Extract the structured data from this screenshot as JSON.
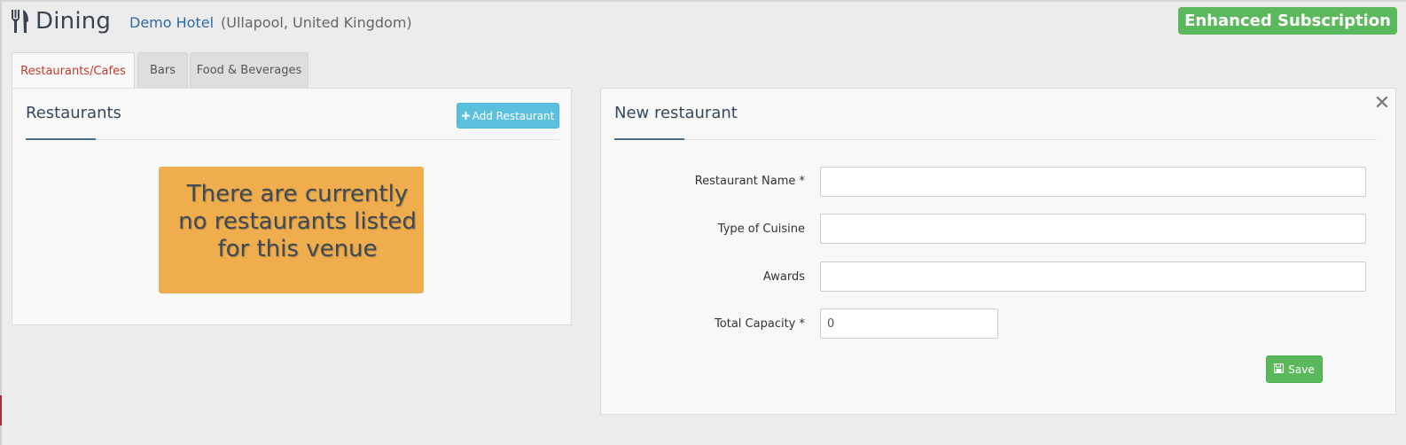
{
  "header": {
    "title": "Dining",
    "hotel_name": "Demo Hotel",
    "hotel_location": "(Ullapool, United Kingdom)",
    "subscription": "Enhanced Subscription",
    "icon": "utensils-icon"
  },
  "tabs": [
    {
      "label": "Restaurants/Cafes",
      "active": true
    },
    {
      "label": "Bars",
      "active": false
    },
    {
      "label": "Food & Beverages",
      "active": false
    }
  ],
  "restaurants_panel": {
    "title": "Restaurants",
    "add_button": "Add Restaurant",
    "empty_message": "There are currently no restaurants listed for this venue"
  },
  "new_restaurant_panel": {
    "title": "New restaurant",
    "close_icon": "close-icon",
    "fields": {
      "name": {
        "label": "Restaurant Name *",
        "value": ""
      },
      "cuisine": {
        "label": "Type of Cuisine",
        "value": ""
      },
      "awards": {
        "label": "Awards",
        "value": ""
      },
      "capacity": {
        "label": "Total Capacity *",
        "value": "0"
      }
    },
    "save_button": "Save"
  },
  "colors": {
    "accent_green": "#5cb85c",
    "info_blue": "#5bc0de",
    "warning_orange": "#f0ad4e",
    "active_tab_red": "#c0392b"
  }
}
